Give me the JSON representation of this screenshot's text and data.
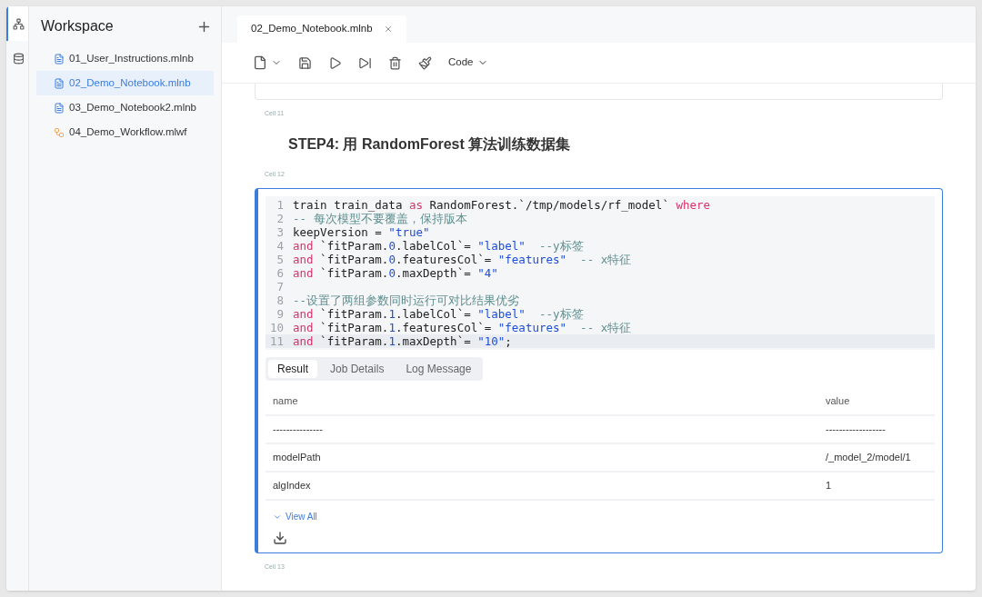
{
  "activity_bar": [
    {
      "kind": "tree",
      "selected": true
    },
    {
      "kind": "database",
      "selected": false
    }
  ],
  "sidebar": {
    "title": "Workspace",
    "items": [
      {
        "label": "01_User_Instructions.mlnb",
        "kind": "notebook",
        "selected": false
      },
      {
        "label": "02_Demo_Notebook.mlnb",
        "kind": "notebook",
        "selected": true
      },
      {
        "label": "03_Demo_Notebook2.mlnb",
        "kind": "notebook",
        "selected": false
      },
      {
        "label": "04_Demo_Workflow.mlwf",
        "kind": "workflow",
        "selected": false
      }
    ]
  },
  "tabs": [
    {
      "label": "02_Demo_Notebook.mlnb",
      "selected": true
    }
  ],
  "toolbar": {
    "cell_type": "Code"
  },
  "cells": [
    {
      "kind": "label",
      "text": "Cell 11"
    },
    {
      "kind": "markdown",
      "text": "STEP4: 用 RandomForest 算法训练数据集"
    },
    {
      "kind": "label",
      "text": "Cell 12"
    },
    {
      "kind": "code",
      "lines": [
        {
          "number": "1",
          "tokens": [
            {
              "text": "train train_data ",
              "kind": "plain"
            },
            {
              "text": "as",
              "kind": "kw"
            },
            {
              "text": " RandomForest.`/tmp/models/rf_model` ",
              "kind": "plain"
            },
            {
              "text": "where",
              "kind": "kw"
            }
          ]
        },
        {
          "number": "2",
          "tokens": [
            {
              "text": "-- 每次模型不要覆盖，保持版本",
              "kind": "comment"
            }
          ]
        },
        {
          "number": "3",
          "tokens": [
            {
              "text": "keepVersion = ",
              "kind": "plain"
            },
            {
              "text": "\"true\"",
              "kind": "str"
            }
          ]
        },
        {
          "number": "4",
          "tokens": [
            {
              "text": "and",
              "kind": "kw"
            },
            {
              "text": " `fitParam.",
              "kind": "plain"
            },
            {
              "text": "0",
              "kind": "num"
            },
            {
              "text": ".labelCol`= ",
              "kind": "plain"
            },
            {
              "text": "\"label\"",
              "kind": "str"
            },
            {
              "text": "  --y标签",
              "kind": "comment"
            }
          ]
        },
        {
          "number": "5",
          "tokens": [
            {
              "text": "and",
              "kind": "kw"
            },
            {
              "text": " `fitParam.",
              "kind": "plain"
            },
            {
              "text": "0",
              "kind": "num"
            },
            {
              "text": ".featuresCol`= ",
              "kind": "plain"
            },
            {
              "text": "\"features\"",
              "kind": "str"
            },
            {
              "text": "  -- x特征",
              "kind": "comment"
            }
          ]
        },
        {
          "number": "6",
          "tokens": [
            {
              "text": "and",
              "kind": "kw"
            },
            {
              "text": " `fitParam.",
              "kind": "plain"
            },
            {
              "text": "0",
              "kind": "num"
            },
            {
              "text": ".maxDepth`= ",
              "kind": "plain"
            },
            {
              "text": "\"4\"",
              "kind": "str"
            }
          ]
        },
        {
          "number": "7"
        },
        {
          "number": "8",
          "tokens": [
            {
              "text": "--设置了两组参数同时运行可对比结果优劣",
              "kind": "comment"
            }
          ]
        },
        {
          "number": "9",
          "tokens": [
            {
              "text": "and",
              "kind": "kw"
            },
            {
              "text": " `fitParam.",
              "kind": "plain"
            },
            {
              "text": "1",
              "kind": "num"
            },
            {
              "text": ".labelCol`= ",
              "kind": "plain"
            },
            {
              "text": "\"label\"",
              "kind": "str"
            },
            {
              "text": "  --y标签",
              "kind": "comment"
            }
          ]
        },
        {
          "number": "10",
          "tokens": [
            {
              "text": "and",
              "kind": "kw"
            },
            {
              "text": " `fitParam.",
              "kind": "plain"
            },
            {
              "text": "1",
              "kind": "num"
            },
            {
              "text": ".featuresCol`= ",
              "kind": "plain"
            },
            {
              "text": "\"features\"",
              "kind": "str"
            },
            {
              "text": "  -- x特征",
              "kind": "comment"
            }
          ]
        },
        {
          "number": "11",
          "tokens": [
            {
              "text": "and",
              "kind": "kw"
            },
            {
              "text": " `fitParam.",
              "kind": "plain"
            },
            {
              "text": "1",
              "kind": "num"
            },
            {
              "text": ".maxDepth`= ",
              "kind": "plain"
            },
            {
              "text": "\"10\"",
              "kind": "str"
            },
            {
              "text": ";",
              "kind": "plain"
            }
          ]
        }
      ],
      "result_tabs": [
        {
          "label": "Result",
          "selected": true
        },
        {
          "label": "Job Details",
          "selected": false
        },
        {
          "label": "Log Message",
          "selected": false
        }
      ],
      "table": {
        "columns": [
          "name",
          "value"
        ],
        "rows": [
          [
            "---------------",
            "------------------"
          ],
          [
            "modelPath",
            "/_model_2/model/1"
          ],
          [
            "algIndex",
            "1"
          ]
        ]
      },
      "view_all": "View All"
    },
    {
      "kind": "label",
      "text": "Cell 13"
    }
  ]
}
